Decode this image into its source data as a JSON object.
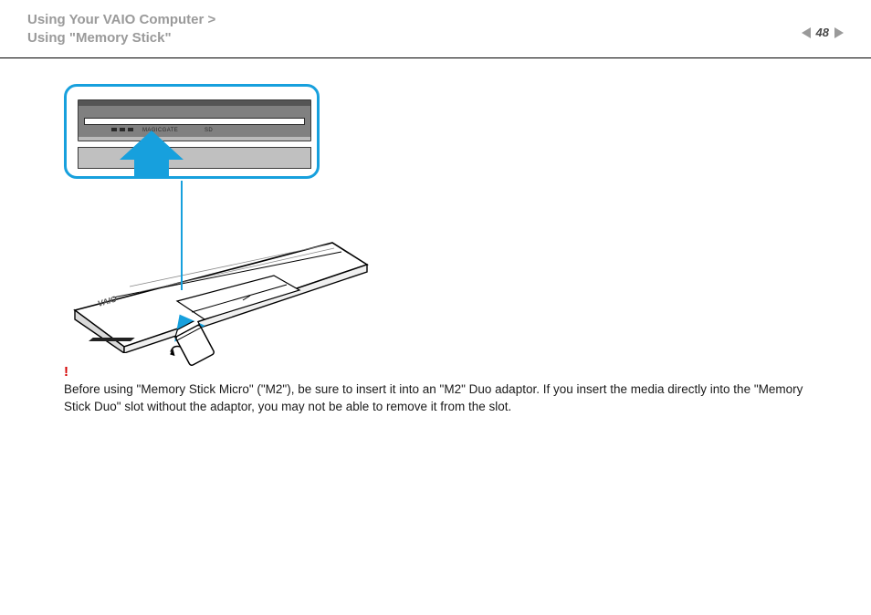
{
  "header": {
    "line1": "Using Your VAIO Computer >",
    "line2": "Using \"Memory Stick\""
  },
  "page_number": "48",
  "nav": {
    "prev": "previous page",
    "next": "next page"
  },
  "diagram": {
    "callout_label_magicgate": "MAGICGATE",
    "callout_label_sd": "SD",
    "laptop_logo": "VAIO",
    "memory_stick_alt": "Memory Stick Duo",
    "insert_arrow_alt": "insert direction",
    "zoom_arrow_alt": "zoomed view"
  },
  "warning": {
    "mark": "!",
    "text": "Before using \"Memory Stick Micro\" (\"M2\"), be sure to insert it into an \"M2\" Duo adaptor. If you insert the media directly into the \"Memory Stick Duo\" slot without the adaptor, you may not be able to remove it from the slot."
  }
}
